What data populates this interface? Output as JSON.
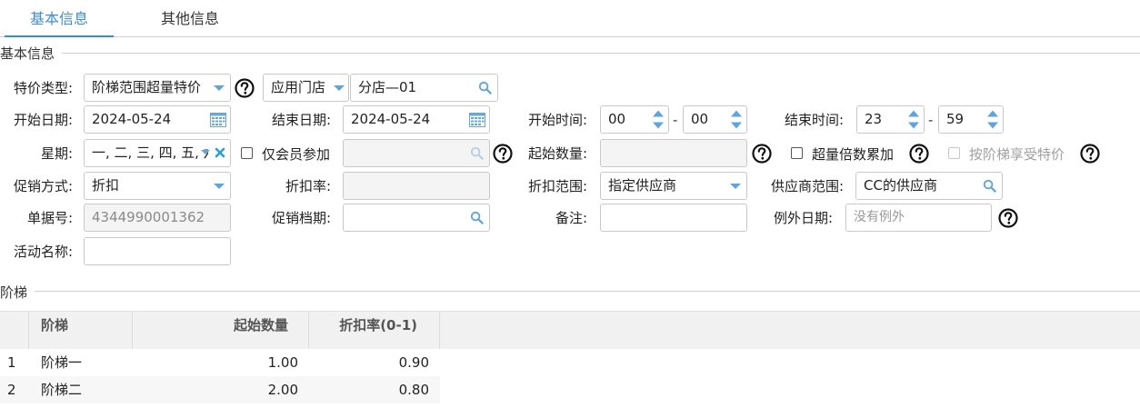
{
  "tabs": [
    {
      "label": "基本信息",
      "active": true
    },
    {
      "label": "其他信息",
      "active": false
    }
  ],
  "basic_section": {
    "legend": "基本信息"
  },
  "fields": {
    "promo_type": {
      "label": "特价类型:",
      "value": "阶梯范围超量特价"
    },
    "apply_scope": {
      "value": "应用门店"
    },
    "store": {
      "value": "分店—01"
    },
    "start_date": {
      "label": "开始日期:",
      "value": "2024-05-24"
    },
    "end_date": {
      "label": "结束日期:",
      "value": "2024-05-24"
    },
    "start_time": {
      "label": "开始时间:",
      "hour": "00",
      "minute": "00"
    },
    "end_time": {
      "label": "结束时间:",
      "hour": "23",
      "minute": "59"
    },
    "time_separator": "-",
    "weekday": {
      "label": "星期:",
      "value": "一, 二, 三, 四, 五, 六"
    },
    "member_only": {
      "label": "仅会员参加",
      "checked": false
    },
    "start_qty": {
      "label": "起始数量:",
      "value": ""
    },
    "over_multiple": {
      "label": "超量倍数累加",
      "checked": false
    },
    "tier_price": {
      "label": "按阶梯享受特价",
      "checked": false
    },
    "promo_method": {
      "label": "促销方式:",
      "value": "折扣"
    },
    "discount_rate": {
      "label": "折扣率:",
      "value": ""
    },
    "discount_scope": {
      "label": "折扣范围:",
      "value": "指定供应商"
    },
    "supplier_scope": {
      "label": "供应商范围:",
      "value": "CC的供应商"
    },
    "doc_no": {
      "label": "单据号:",
      "value": "4344990001362"
    },
    "promo_period": {
      "label": "促销档期:",
      "value": ""
    },
    "remark": {
      "label": "备注:",
      "value": ""
    },
    "exception_date": {
      "label": "例外日期:",
      "placeholder": "没有例外"
    },
    "activity_name": {
      "label": "活动名称:",
      "value": ""
    }
  },
  "tier_section": {
    "legend": "阶梯"
  },
  "tier_table": {
    "columns": [
      "阶梯",
      "起始数量",
      "折扣率(0-1)"
    ],
    "rows": [
      {
        "index": "1",
        "tier": "阶梯一",
        "qty": "1.00",
        "rate": "0.90"
      },
      {
        "index": "2",
        "tier": "阶梯二",
        "qty": "2.00",
        "rate": "0.80"
      }
    ]
  },
  "colors": {
    "accent": "#2f8de4",
    "icon_blue": "#5fa4dd",
    "clear_x": "#2a9fd8"
  }
}
